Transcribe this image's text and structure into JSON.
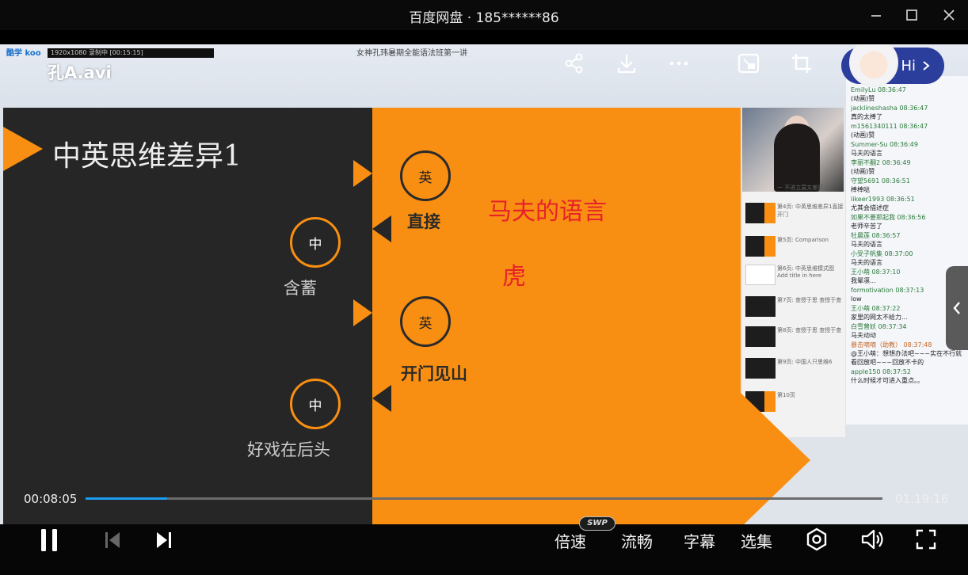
{
  "window": {
    "title": "百度网盘 · 185******86"
  },
  "video": {
    "file_name": "孔A.avi",
    "lesson_title": "女神孔玮暑期全能语法班第一讲",
    "recorder_bar": "1920x1080  录制中 [00:15:15]",
    "logo_text": "酷学 koo",
    "hi_label": "Hi"
  },
  "slide": {
    "heading": "中英思维差异1",
    "bullets": [
      {
        "tag": "英",
        "label": "直接"
      },
      {
        "tag": "中",
        "label": "含蓄"
      },
      {
        "tag": "英",
        "label": "开门见山"
      },
      {
        "tag": "中",
        "label": "好戏在后头"
      }
    ],
    "notes": [
      "马夫的语言",
      "虎"
    ]
  },
  "thumbnails": [
    {
      "caption": "一 不进立莫文差感"
    },
    {
      "caption": "第4页: 中英思维差异1直接开门"
    },
    {
      "caption": "第5页: Comparison"
    },
    {
      "caption": "第6页: 中英思维模式图 Add title in here"
    },
    {
      "caption": "第7页: 查授于思 查授于查"
    },
    {
      "caption": "第8页: 查授于思 查授于查"
    },
    {
      "caption": "第9页: 中国人只思维6"
    },
    {
      "caption": "第10页"
    }
  ],
  "chat": [
    {
      "name": "EmilyLu 08:36:47",
      "msg": "(动画)赞"
    },
    {
      "name": "jacklineshasha 08:36:47",
      "msg": "真的太棒了"
    },
    {
      "name": "m1561340111 08:36:47",
      "msg": "(动画)赞"
    },
    {
      "name": "Summer-Su 08:36:49",
      "msg": "马夫的语言"
    },
    {
      "name": "李丽不翻2 08:36:49",
      "msg": "(动画)赞"
    },
    {
      "name": "守望5691 08:36:51",
      "msg": "棒棒哒"
    },
    {
      "name": "likeer1993 08:36:51",
      "msg": "尤其会描述症"
    },
    {
      "name": "如果不要那起我 08:36:56",
      "msg": "老师辛苦了"
    },
    {
      "name": "牡晨莲 08:36:57",
      "msg": "马夫的语言"
    },
    {
      "name": "小受子帆集 08:37:00",
      "msg": "马夫的语言"
    },
    {
      "name": "王小萌 08:37:10",
      "msg": "我晕凛..."
    },
    {
      "name": "formotivation 08:37:13",
      "msg": "low"
    },
    {
      "name": "王小萌 08:37:22",
      "msg": "家里的网太不给力..."
    },
    {
      "name": "白雪曾妖 08:37:34",
      "msg": "马夫动动"
    },
    {
      "name": "暴击嘀嘀（助教） 08:37:48",
      "msg": "@王小萌：想想办法吧~~~实在不行就看回放吧~~~回放不卡的"
    },
    {
      "name": "apple150 08:37:52",
      "msg": "什么时候才可进入重点。。"
    }
  ],
  "playback": {
    "current_time": "00:08:05",
    "total_time": "01:19:16",
    "progress": 0.102
  },
  "controls": {
    "speed_label": "倍速",
    "quality_label": "流畅",
    "subtitle_label": "字幕",
    "episodes_label": "选集",
    "swp_badge": "SWP"
  },
  "colors": {
    "accent_blue": "#1a9cf0",
    "slide_orange": "#f98f12",
    "slide_dark": "#262626",
    "note_red": "#e6222a"
  }
}
